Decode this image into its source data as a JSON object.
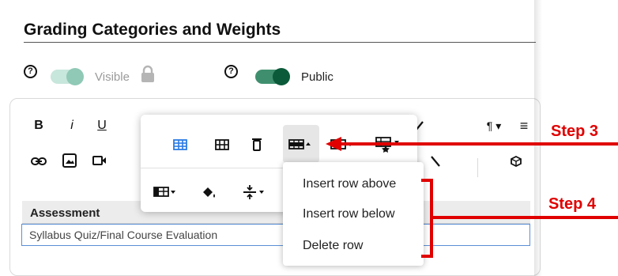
{
  "page": {
    "title": "Grading Categories and Weights"
  },
  "toggles": [
    {
      "help": "?",
      "label": "Visible",
      "state": "disabled-on",
      "track_color": "#a3d4c4",
      "knob_color": "#8cc7b3"
    },
    {
      "help": "?",
      "label": "Public",
      "state": "on",
      "track_color": "#3a8a6a",
      "knob_color": "#0b5a3a"
    }
  ],
  "toolbar": {
    "row1": [
      {
        "glyph": "B",
        "icon": "bold-icon"
      },
      {
        "glyph": "i",
        "icon": "italic-icon"
      },
      {
        "glyph": "U",
        "icon": "underline-icon"
      },
      {
        "glyph": "¶ ▾",
        "icon": "paragraph-icon"
      },
      {
        "glyph": "≡",
        "icon": "align-icon"
      }
    ],
    "row2": [
      {
        "icon": "link-icon"
      },
      {
        "icon": "image-icon"
      },
      {
        "icon": "video-icon"
      },
      {
        "icon": "cube-icon"
      }
    ]
  },
  "popup_toolbar": {
    "row1": [
      "table-properties-icon",
      "table-icon",
      "delete-table-icon",
      "row-icon",
      "column-icon",
      "cell-icon"
    ],
    "row2": [
      "cell-style-icon",
      "fill-color-icon",
      "vertical-align-icon"
    ]
  },
  "row_menu": {
    "items": [
      "Insert row above",
      "Insert row below",
      "Delete row"
    ]
  },
  "table": {
    "header": "Assessment",
    "rows": [
      "Syllabus Quiz/Final Course Evaluation"
    ]
  },
  "annotations": {
    "step3": "Step 3",
    "step4": "Step 4",
    "color": "#e00000"
  }
}
